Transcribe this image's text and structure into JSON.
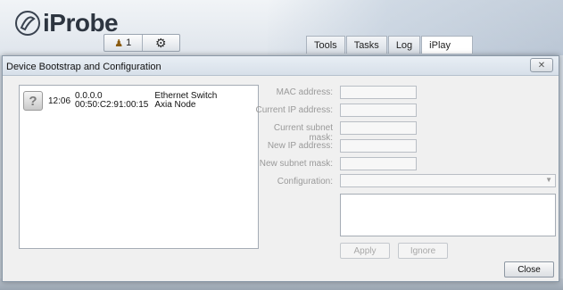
{
  "app": {
    "logo_text": "iProbe",
    "toolbar": {
      "user_count": "1"
    },
    "tabs": [
      {
        "label": "Tools"
      },
      {
        "label": "Tasks"
      },
      {
        "label": "Log"
      },
      {
        "label": "iPlay"
      }
    ]
  },
  "dialog": {
    "title": "Device Bootstrap and Configuration",
    "close_glyph": "✕",
    "devices": [
      {
        "time": "12:06",
        "ip": "0.0.0.0",
        "mac": "00:50:C2:91:00:15",
        "type": "Ethernet Switch",
        "node": "Axia Node"
      }
    ],
    "form": {
      "mac_label": "MAC address:",
      "current_ip_label": "Current IP address:",
      "current_mask_label": "Current subnet mask:",
      "new_ip_label": "New IP address:",
      "new_mask_label": "New subnet mask:",
      "config_label": "Configuration:",
      "mac_value": "",
      "current_ip_value": "",
      "current_mask_value": "",
      "new_ip_value": "",
      "new_mask_value": "",
      "config_value": ""
    },
    "buttons": {
      "apply": "Apply",
      "ignore": "Ignore",
      "close": "Close"
    }
  }
}
